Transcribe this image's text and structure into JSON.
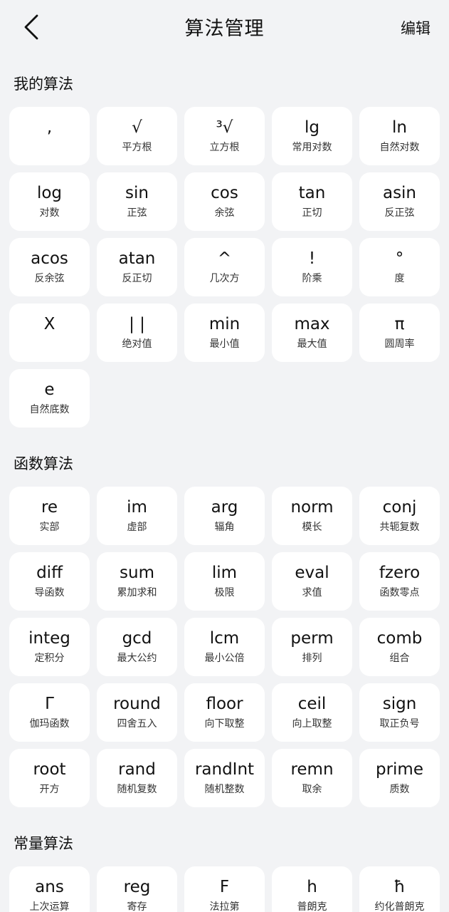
{
  "header": {
    "title": "算法管理",
    "edit_label": "编辑"
  },
  "sections": {
    "mine": {
      "title": "我的算法",
      "items": [
        {
          "sym": ",",
          "desc": ""
        },
        {
          "sym": "√",
          "desc": "平方根"
        },
        {
          "sym": "³√",
          "desc": "立方根"
        },
        {
          "sym": "lg",
          "desc": "常用对数"
        },
        {
          "sym": "ln",
          "desc": "自然对数"
        },
        {
          "sym": "log",
          "desc": "对数"
        },
        {
          "sym": "sin",
          "desc": "正弦"
        },
        {
          "sym": "cos",
          "desc": "余弦"
        },
        {
          "sym": "tan",
          "desc": "正切"
        },
        {
          "sym": "asin",
          "desc": "反正弦"
        },
        {
          "sym": "acos",
          "desc": "反余弦"
        },
        {
          "sym": "atan",
          "desc": "反正切"
        },
        {
          "sym": "^",
          "desc": "几次方"
        },
        {
          "sym": "!",
          "desc": "阶乘"
        },
        {
          "sym": "°",
          "desc": "度"
        },
        {
          "sym": "X",
          "desc": ""
        },
        {
          "sym": "| |",
          "desc": "绝对值"
        },
        {
          "sym": "min",
          "desc": "最小值"
        },
        {
          "sym": "max",
          "desc": "最大值"
        },
        {
          "sym": "π",
          "desc": "圆周率"
        },
        {
          "sym": "e",
          "desc": "自然底数"
        }
      ]
    },
    "functions": {
      "title": "函数算法",
      "items": [
        {
          "sym": "re",
          "desc": "实部"
        },
        {
          "sym": "im",
          "desc": "虚部"
        },
        {
          "sym": "arg",
          "desc": "辐角"
        },
        {
          "sym": "norm",
          "desc": "模长"
        },
        {
          "sym": "conj",
          "desc": "共轭复数"
        },
        {
          "sym": "diff",
          "desc": "导函数"
        },
        {
          "sym": "sum",
          "desc": "累加求和"
        },
        {
          "sym": "lim",
          "desc": "极限"
        },
        {
          "sym": "eval",
          "desc": "求值"
        },
        {
          "sym": "fzero",
          "desc": "函数零点"
        },
        {
          "sym": "integ",
          "desc": "定积分"
        },
        {
          "sym": "gcd",
          "desc": "最大公约"
        },
        {
          "sym": "lcm",
          "desc": "最小公倍"
        },
        {
          "sym": "perm",
          "desc": "排列"
        },
        {
          "sym": "comb",
          "desc": "组合"
        },
        {
          "sym": "Γ",
          "desc": "伽玛函数"
        },
        {
          "sym": "round",
          "desc": "四舍五入"
        },
        {
          "sym": "floor",
          "desc": "向下取整"
        },
        {
          "sym": "ceil",
          "desc": "向上取整"
        },
        {
          "sym": "sign",
          "desc": "取正负号"
        },
        {
          "sym": "root",
          "desc": "开方"
        },
        {
          "sym": "rand",
          "desc": "随机复数"
        },
        {
          "sym": "randInt",
          "desc": "随机整数"
        },
        {
          "sym": "remn",
          "desc": "取余"
        },
        {
          "sym": "prime",
          "desc": "质数"
        }
      ]
    },
    "constants": {
      "title": "常量算法",
      "items": [
        {
          "sym": "ans",
          "desc": "上次运算"
        },
        {
          "sym": "reg",
          "desc": "寄存"
        },
        {
          "sym": "F",
          "desc": "法拉第"
        },
        {
          "sym": "h",
          "desc": "普朗克"
        },
        {
          "sym": "ħ",
          "desc": "约化普朗克"
        }
      ]
    }
  }
}
